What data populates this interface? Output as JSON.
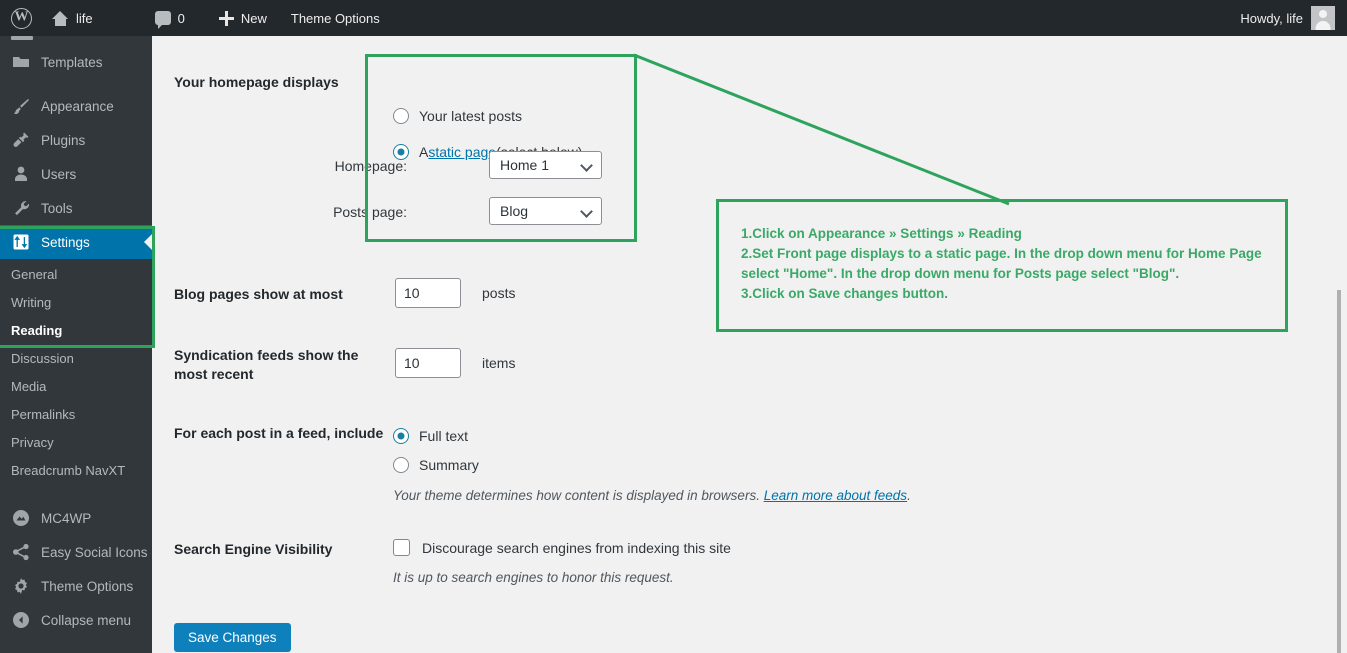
{
  "adminbar": {
    "site_title": "life",
    "comment_count": "0",
    "new_label": "New",
    "theme_options_label": "Theme Options",
    "howdy": "Howdy, life",
    "icons": {
      "wp_logo": "wordpress-logo-icon",
      "home": "home-icon",
      "comments": "comment-bubble-icon",
      "new": "plus-icon",
      "avatar": "user-avatar-icon"
    }
  },
  "sidebar": {
    "items": [
      {
        "label": "Templates",
        "icon": "folder-icon",
        "active": false
      },
      {
        "label": "Appearance",
        "icon": "paintbrush-icon",
        "active": false
      },
      {
        "label": "Plugins",
        "icon": "plug-icon",
        "active": false
      },
      {
        "label": "Users",
        "icon": "user-icon",
        "active": false
      },
      {
        "label": "Tools",
        "icon": "wrench-icon",
        "active": false
      },
      {
        "label": "Settings",
        "icon": "settings-sliders-icon",
        "active": true
      }
    ],
    "submenu": [
      {
        "label": "General",
        "current": false
      },
      {
        "label": "Writing",
        "current": false
      },
      {
        "label": "Reading",
        "current": true
      },
      {
        "label": "Discussion",
        "current": false
      },
      {
        "label": "Media",
        "current": false
      },
      {
        "label": "Permalinks",
        "current": false
      },
      {
        "label": "Privacy",
        "current": false
      },
      {
        "label": "Breadcrumb NavXT",
        "current": false
      }
    ],
    "bottom_items": [
      {
        "label": "MC4WP",
        "icon": "mailchimp-icon"
      },
      {
        "label": "Easy Social Icons",
        "icon": "share-icon"
      },
      {
        "label": "Theme Options",
        "icon": "gear-icon"
      },
      {
        "label": "Collapse menu",
        "icon": "collapse-arrow-icon"
      }
    ]
  },
  "settings": {
    "homepage_displays": {
      "label": "Your homepage displays",
      "option_latest": "Your latest posts",
      "option_static_prefix": "A ",
      "option_static_link": "static page",
      "option_static_suffix": " (select below)",
      "homepage_label": "Homepage:",
      "homepage_value": "Home 1",
      "posts_page_label": "Posts page:",
      "posts_page_value": "Blog"
    },
    "blog_pages": {
      "label": "Blog pages show at most",
      "value": "10",
      "unit": "posts"
    },
    "syndication": {
      "label": "Syndication feeds show the most recent",
      "value": "10",
      "unit": "items"
    },
    "feed_include": {
      "label": "For each post in a feed, include",
      "option_full": "Full text",
      "option_summary": "Summary",
      "help_prefix": "Your theme determines how content is displayed in browsers. ",
      "help_link": "Learn more about feeds",
      "help_suffix": "."
    },
    "search_visibility": {
      "label": "Search Engine Visibility",
      "checkbox_label": "Discourage search engines from indexing this site",
      "help": "It is up to search engines to honor this request."
    },
    "save_label": "Save Changes"
  },
  "annotation": {
    "text": "1.Click on Appearance » Settings » Reading\n2.Set Front page displays to a static page. In the drop down menu for Home Page select \"Home\". In the drop down menu for Posts page select \"Blog\".\n3.Click on Save changes button.",
    "color": "#2ea35c"
  },
  "colors": {
    "accent_blue": "#0073aa",
    "button_blue": "#0e81bd",
    "annotation_green": "#2ea35c",
    "admin_bar": "#23282d",
    "sidebar": "#32373c",
    "content_bg": "#f1f1f1"
  }
}
